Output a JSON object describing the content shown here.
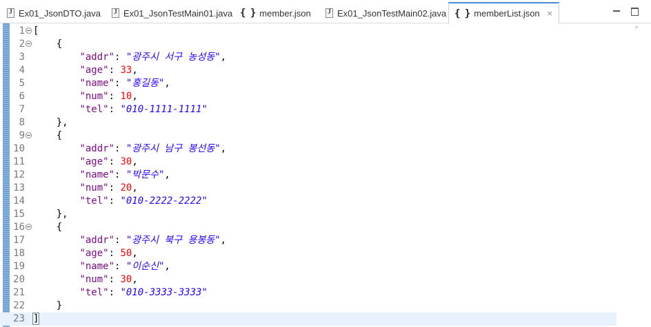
{
  "tabs": [
    {
      "label": "Ex01_JsonDTO.java",
      "icon": "java-file-icon",
      "active": false
    },
    {
      "label": "Ex01_JsonTestMain01.java",
      "icon": "java-file-icon",
      "active": false
    },
    {
      "label": "member.json",
      "icon": "json-file-icon",
      "active": false
    },
    {
      "label": "Ex01_JsonTestMain02.java",
      "icon": "java-file-icon",
      "active": false
    },
    {
      "label": "memberList.json",
      "icon": "json-file-icon",
      "active": true,
      "close": "⨯"
    }
  ],
  "json_icon_glyph": "{ }",
  "editor": {
    "lines": [
      {
        "n": "1",
        "fold": true,
        "tokens": [
          [
            "p",
            "["
          ]
        ]
      },
      {
        "n": "2",
        "fold": true,
        "tokens": [
          [
            "p",
            "    {"
          ]
        ]
      },
      {
        "n": "3",
        "tokens": [
          [
            "p",
            "        "
          ],
          [
            "k",
            "\"addr\""
          ],
          [
            "p",
            ": "
          ],
          [
            "s",
            "\"광주시 서구 농성동\""
          ],
          [
            "p",
            ","
          ]
        ]
      },
      {
        "n": "4",
        "tokens": [
          [
            "p",
            "        "
          ],
          [
            "k",
            "\"age\""
          ],
          [
            "p",
            ": "
          ],
          [
            "n",
            "33"
          ],
          [
            "p",
            ","
          ]
        ]
      },
      {
        "n": "5",
        "tokens": [
          [
            "p",
            "        "
          ],
          [
            "k",
            "\"name\""
          ],
          [
            "p",
            ": "
          ],
          [
            "s",
            "\"홍길동\""
          ],
          [
            "p",
            ","
          ]
        ]
      },
      {
        "n": "6",
        "tokens": [
          [
            "p",
            "        "
          ],
          [
            "k",
            "\"num\""
          ],
          [
            "p",
            ": "
          ],
          [
            "n",
            "10"
          ],
          [
            "p",
            ","
          ]
        ]
      },
      {
        "n": "7",
        "tokens": [
          [
            "p",
            "        "
          ],
          [
            "k",
            "\"tel\""
          ],
          [
            "p",
            ": "
          ],
          [
            "s",
            "\"010-1111-1111\""
          ]
        ]
      },
      {
        "n": "8",
        "tokens": [
          [
            "p",
            "    },"
          ]
        ]
      },
      {
        "n": "9",
        "fold": true,
        "tokens": [
          [
            "p",
            "    {"
          ]
        ]
      },
      {
        "n": "10",
        "tokens": [
          [
            "p",
            "        "
          ],
          [
            "k",
            "\"addr\""
          ],
          [
            "p",
            ": "
          ],
          [
            "s",
            "\"광주시 남구 봉선동\""
          ],
          [
            "p",
            ","
          ]
        ]
      },
      {
        "n": "11",
        "tokens": [
          [
            "p",
            "        "
          ],
          [
            "k",
            "\"age\""
          ],
          [
            "p",
            ": "
          ],
          [
            "n",
            "30"
          ],
          [
            "p",
            ","
          ]
        ]
      },
      {
        "n": "12",
        "tokens": [
          [
            "p",
            "        "
          ],
          [
            "k",
            "\"name\""
          ],
          [
            "p",
            ": "
          ],
          [
            "s",
            "\"박문수\""
          ],
          [
            "p",
            ","
          ]
        ]
      },
      {
        "n": "13",
        "tokens": [
          [
            "p",
            "        "
          ],
          [
            "k",
            "\"num\""
          ],
          [
            "p",
            ": "
          ],
          [
            "n",
            "20"
          ],
          [
            "p",
            ","
          ]
        ]
      },
      {
        "n": "14",
        "tokens": [
          [
            "p",
            "        "
          ],
          [
            "k",
            "\"tel\""
          ],
          [
            "p",
            ": "
          ],
          [
            "s",
            "\"010-2222-2222\""
          ]
        ]
      },
      {
        "n": "15",
        "tokens": [
          [
            "p",
            "    },"
          ]
        ]
      },
      {
        "n": "16",
        "fold": true,
        "tokens": [
          [
            "p",
            "    {"
          ]
        ]
      },
      {
        "n": "17",
        "tokens": [
          [
            "p",
            "        "
          ],
          [
            "k",
            "\"addr\""
          ],
          [
            "p",
            ": "
          ],
          [
            "s",
            "\"광주시 북구 용봉동\""
          ],
          [
            "p",
            ","
          ]
        ]
      },
      {
        "n": "18",
        "tokens": [
          [
            "p",
            "        "
          ],
          [
            "k",
            "\"age\""
          ],
          [
            "p",
            ": "
          ],
          [
            "n",
            "50"
          ],
          [
            "p",
            ","
          ]
        ]
      },
      {
        "n": "19",
        "tokens": [
          [
            "p",
            "        "
          ],
          [
            "k",
            "\"name\""
          ],
          [
            "p",
            ": "
          ],
          [
            "s",
            "\"이순신\""
          ],
          [
            "p",
            ","
          ]
        ]
      },
      {
        "n": "20",
        "tokens": [
          [
            "p",
            "        "
          ],
          [
            "k",
            "\"num\""
          ],
          [
            "p",
            ": "
          ],
          [
            "n",
            "30"
          ],
          [
            "p",
            ","
          ]
        ]
      },
      {
        "n": "21",
        "tokens": [
          [
            "p",
            "        "
          ],
          [
            "k",
            "\"tel\""
          ],
          [
            "p",
            ": "
          ],
          [
            "s",
            "\"010-3333-3333\""
          ]
        ]
      },
      {
        "n": "22",
        "tokens": [
          [
            "p",
            "    }"
          ]
        ]
      },
      {
        "n": "23",
        "current": true,
        "tokens": [
          [
            "p",
            "]"
          ]
        ]
      }
    ]
  },
  "colors": {
    "key": "#7f0a87",
    "string": "#2a00ff",
    "number": "#ff0000",
    "active_tab_accent": "#4a8ad9",
    "current_line": "#e8f2fe"
  }
}
